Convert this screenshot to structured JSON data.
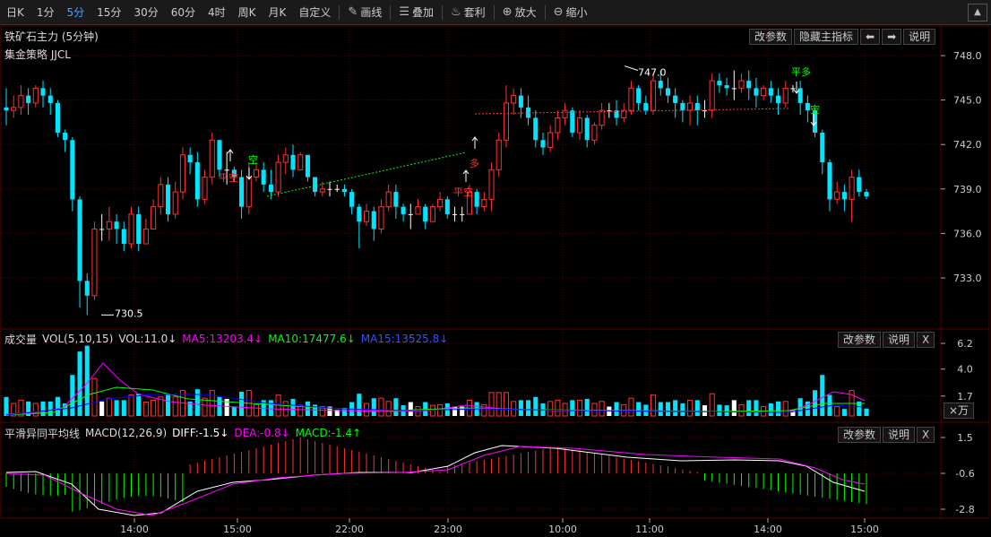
{
  "toolbar": {
    "periods": [
      "日K",
      "1分",
      "5分",
      "15分",
      "30分",
      "60分",
      "4时",
      "周K",
      "月K",
      "自定义"
    ],
    "active_period": "5分",
    "tools": [
      {
        "label": "画线",
        "icon": "pencil-icon",
        "glyph": "✎"
      },
      {
        "label": "叠加",
        "icon": "layers-icon",
        "glyph": "☰"
      },
      {
        "label": "套利",
        "icon": "money-bag-icon",
        "glyph": "♨"
      },
      {
        "label": "放大",
        "icon": "zoom-in-icon",
        "glyph": "⊕"
      },
      {
        "label": "缩小",
        "icon": "zoom-out-icon",
        "glyph": "⊖"
      }
    ],
    "collapse_glyph": "▲"
  },
  "main_chart": {
    "title": "铁矿石主力 (5分钟)",
    "strategy": "集金策略 JJCL",
    "buttons": {
      "params": "改参数",
      "hide": "隐藏主指标",
      "left": "⬅",
      "right": "➡",
      "help": "说明"
    },
    "y_ticks": [
      "748.0",
      "745.0",
      "742.0",
      "739.0",
      "736.0",
      "733.0"
    ],
    "annotations": {
      "low": "730.5",
      "high": "747.0",
      "ping_duo": "平多",
      "kong1": "空",
      "kong2": "空",
      "ping_kong1": "平空",
      "ping_kong2": "平空",
      "duo": "多"
    }
  },
  "volume": {
    "label": "成交量",
    "name": "VOL(5,10,15)",
    "vol": "VOL:11.0↓",
    "ma5": "MA5:13203.4↓",
    "ma10": "MA10:17477.6↓",
    "ma15": "MA15:13525.8↓",
    "buttons": {
      "params": "改参数",
      "help": "说明",
      "close": "X"
    },
    "y_ticks": [
      "6.2",
      "4.0",
      "1.7"
    ],
    "unit": "×万"
  },
  "macd": {
    "label": "平滑异同平均线",
    "name": "MACD(12,26,9)",
    "diff": "DIFF:-1.5↓",
    "dea": "DEA:-0.8↓",
    "macd": "MACD:-1.4↑",
    "buttons": {
      "params": "改参数",
      "help": "说明",
      "close": "X"
    },
    "y_ticks": [
      "1.5",
      "-0.6",
      "-2.8"
    ]
  },
  "time_axis": [
    "14:00",
    "15:00",
    "22:00",
    "23:00",
    "10:00",
    "11:00",
    "14:00",
    "15:00"
  ],
  "colors": {
    "up": "#ff3232",
    "down": "#00e5ff",
    "flat": "#ffffff",
    "ma5": "#ff00ff",
    "ma10": "#00ff00",
    "ma15": "#0000ff",
    "diff": "#ffffff",
    "dea": "#ff00ff",
    "macd_pos": "#ff3232",
    "macd_neg": "#00ff00",
    "grid": "#5a0000",
    "accent": "#4aa3ff"
  },
  "chart_data": {
    "type": "candlestick",
    "title": "铁矿石主力 (5分钟)",
    "ylim": [
      730.0,
      749.0
    ],
    "candles": [
      [
        744.5,
        744.3,
        743.3,
        745.8
      ],
      [
        744.3,
        744.5,
        743.8,
        745.3
      ],
      [
        744.5,
        745.3,
        744.0,
        746.0
      ],
      [
        745.3,
        744.8,
        744.0,
        745.8
      ],
      [
        744.8,
        745.8,
        744.5,
        746.0
      ],
      [
        745.8,
        745.3,
        744.5,
        746.3
      ],
      [
        745.3,
        744.8,
        744.0,
        745.8
      ],
      [
        744.8,
        742.8,
        742.5,
        745.0
      ],
      [
        742.8,
        742.3,
        741.5,
        743.0
      ],
      [
        742.3,
        738.3,
        737.5,
        742.5
      ],
      [
        738.3,
        732.8,
        731.0,
        738.5
      ],
      [
        732.8,
        731.8,
        730.5,
        733.3
      ],
      [
        731.8,
        736.3,
        731.5,
        736.8
      ],
      [
        736.3,
        736.3,
        735.5,
        737.3
      ],
      [
        736.3,
        736.8,
        735.5,
        737.8
      ],
      [
        736.8,
        736.3,
        735.3,
        737.3
      ],
      [
        736.3,
        735.3,
        734.8,
        736.8
      ],
      [
        735.3,
        737.3,
        735.0,
        737.8
      ],
      [
        737.3,
        735.3,
        734.8,
        737.8
      ],
      [
        735.3,
        736.3,
        735.3,
        737.0
      ],
      [
        736.3,
        737.8,
        736.3,
        738.3
      ],
      [
        737.8,
        739.3,
        737.3,
        739.8
      ],
      [
        739.3,
        737.3,
        736.8,
        739.8
      ],
      [
        737.3,
        738.8,
        737.0,
        739.5
      ],
      [
        738.8,
        741.3,
        738.3,
        741.8
      ],
      [
        741.3,
        740.8,
        740.0,
        741.8
      ],
      [
        740.8,
        738.3,
        737.8,
        741.5
      ],
      [
        738.3,
        739.8,
        738.0,
        740.3
      ],
      [
        739.8,
        742.3,
        739.3,
        742.8
      ],
      [
        742.3,
        740.3,
        739.8,
        742.3
      ],
      [
        740.3,
        740.3,
        739.3,
        741.5
      ],
      [
        740.3,
        739.8,
        739.5,
        740.5
      ],
      [
        739.8,
        737.8,
        737.0,
        740.3
      ],
      [
        737.8,
        739.8,
        737.3,
        740.8
      ],
      [
        739.8,
        740.3,
        739.5,
        740.8
      ],
      [
        740.3,
        739.3,
        738.8,
        740.8
      ],
      [
        739.3,
        738.8,
        738.3,
        740.3
      ],
      [
        738.8,
        740.8,
        738.5,
        741.3
      ],
      [
        740.8,
        741.3,
        740.0,
        741.8
      ],
      [
        741.3,
        740.3,
        739.8,
        742.0
      ],
      [
        740.3,
        741.3,
        740.3,
        741.5
      ],
      [
        741.3,
        739.8,
        739.5,
        741.3
      ],
      [
        739.8,
        738.8,
        738.5,
        739.8
      ],
      [
        738.8,
        739.0,
        738.5,
        739.5
      ],
      [
        739.0,
        739.0,
        738.5,
        739.5
      ],
      [
        739.0,
        739.0,
        738.8,
        739.3
      ],
      [
        739.0,
        738.8,
        738.5,
        739.3
      ],
      [
        738.8,
        737.8,
        737.3,
        739.0
      ],
      [
        737.8,
        736.8,
        735.0,
        738.0
      ],
      [
        736.8,
        737.5,
        736.5,
        738.0
      ],
      [
        737.5,
        736.3,
        735.5,
        737.8
      ],
      [
        736.3,
        737.8,
        736.0,
        738.3
      ],
      [
        737.8,
        738.8,
        737.5,
        739.3
      ],
      [
        738.8,
        737.8,
        737.0,
        739.3
      ],
      [
        737.8,
        737.3,
        736.8,
        738.0
      ],
      [
        737.3,
        737.3,
        736.3,
        738.0
      ],
      [
        737.3,
        737.8,
        737.3,
        738.3
      ],
      [
        737.8,
        736.8,
        736.3,
        738.0
      ],
      [
        736.8,
        737.8,
        736.8,
        738.0
      ],
      [
        737.8,
        738.3,
        737.5,
        738.8
      ],
      [
        738.3,
        737.3,
        737.0,
        738.5
      ],
      [
        737.3,
        737.3,
        736.8,
        737.8
      ],
      [
        737.3,
        737.3,
        736.8,
        737.8
      ],
      [
        737.3,
        738.8,
        737.3,
        739.3
      ],
      [
        738.8,
        737.8,
        737.3,
        739.0
      ],
      [
        737.8,
        738.3,
        737.5,
        738.8
      ],
      [
        738.3,
        740.3,
        737.5,
        740.8
      ],
      [
        740.3,
        742.3,
        739.8,
        742.8
      ],
      [
        742.3,
        744.8,
        741.8,
        746.0
      ],
      [
        744.8,
        745.3,
        744.0,
        745.8
      ],
      [
        745.3,
        744.5,
        743.8,
        745.8
      ],
      [
        744.5,
        743.8,
        743.3,
        745.3
      ],
      [
        743.8,
        742.3,
        741.8,
        744.3
      ],
      [
        742.3,
        741.8,
        741.3,
        742.8
      ],
      [
        741.8,
        742.8,
        741.5,
        743.3
      ],
      [
        742.8,
        743.8,
        742.3,
        744.3
      ],
      [
        743.8,
        744.3,
        743.3,
        744.8
      ],
      [
        744.3,
        742.8,
        742.5,
        744.5
      ],
      [
        742.8,
        743.8,
        742.3,
        744.3
      ],
      [
        743.8,
        742.3,
        741.8,
        744.0
      ],
      [
        742.3,
        743.3,
        742.0,
        743.5
      ],
      [
        743.3,
        744.3,
        743.0,
        744.8
      ],
      [
        744.3,
        744.3,
        743.8,
        744.8
      ],
      [
        744.3,
        743.8,
        743.3,
        745.0
      ],
      [
        743.8,
        744.3,
        743.5,
        744.8
      ],
      [
        744.3,
        745.8,
        744.0,
        746.3
      ],
      [
        745.8,
        744.8,
        744.3,
        746.0
      ],
      [
        744.8,
        744.3,
        744.0,
        745.3
      ],
      [
        744.3,
        746.3,
        744.0,
        746.8
      ],
      [
        746.3,
        745.8,
        745.3,
        747.0
      ],
      [
        745.8,
        745.3,
        744.8,
        746.5
      ],
      [
        745.3,
        744.8,
        743.8,
        745.8
      ],
      [
        744.8,
        744.3,
        743.5,
        745.0
      ],
      [
        744.3,
        744.8,
        743.3,
        745.3
      ],
      [
        744.8,
        744.3,
        743.3,
        745.3
      ],
      [
        744.3,
        744.3,
        743.8,
        745.0
      ],
      [
        744.3,
        746.3,
        743.8,
        746.8
      ],
      [
        746.3,
        746.0,
        745.5,
        746.8
      ],
      [
        746.0,
        745.8,
        745.3,
        746.5
      ],
      [
        745.8,
        745.8,
        745.0,
        747.0
      ],
      [
        745.8,
        746.3,
        745.5,
        746.8
      ],
      [
        746.3,
        745.8,
        745.0,
        747.0
      ],
      [
        745.8,
        745.3,
        744.5,
        746.5
      ],
      [
        745.3,
        745.8,
        745.0,
        746.0
      ],
      [
        745.8,
        745.3,
        744.8,
        746.3
      ],
      [
        745.3,
        744.8,
        744.0,
        745.8
      ],
      [
        744.8,
        745.8,
        744.5,
        746.3
      ],
      [
        745.8,
        745.8,
        745.5,
        746.0
      ],
      [
        745.8,
        744.8,
        744.0,
        746.3
      ],
      [
        744.8,
        744.3,
        743.5,
        745.3
      ],
      [
        744.3,
        742.8,
        742.5,
        744.5
      ],
      [
        742.8,
        740.8,
        740.0,
        743.0
      ],
      [
        740.8,
        738.3,
        737.5,
        741.0
      ],
      [
        738.3,
        738.8,
        738.0,
        739.5
      ],
      [
        738.8,
        738.3,
        737.5,
        739.3
      ],
      [
        738.3,
        739.8,
        736.8,
        740.3
      ],
      [
        739.8,
        738.8,
        738.5,
        740.3
      ],
      [
        738.8,
        738.5,
        738.3,
        739.0
      ]
    ],
    "volume_ma": {
      "MA5": 13203.4,
      "MA10": 17477.6,
      "MA15": 13525.8,
      "VOL": 11.0
    },
    "macd_values": {
      "DIFF": -1.5,
      "DEA": -0.8,
      "MACD": -1.4
    },
    "volume_ylim": [
      0,
      6.2
    ],
    "macd_ylim": [
      -2.8,
      1.5
    ]
  }
}
